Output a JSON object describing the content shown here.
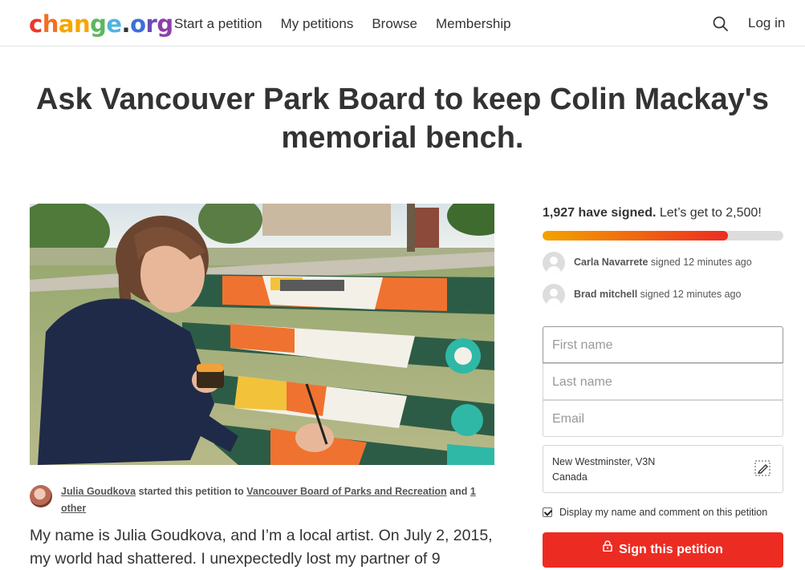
{
  "header": {
    "logo_parts": [
      "c",
      "h",
      "a",
      "n",
      "g",
      "e",
      ".",
      "o",
      "r",
      "g"
    ],
    "logo_colors": [
      "#e8392b",
      "#f36f21",
      "#f7a600",
      "#f7a600",
      "#5db75e",
      "#4fb2e0",
      "#333333",
      "#3e6fd6",
      "#6b4bb5",
      "#8c3fa8"
    ],
    "nav": [
      "Start a petition",
      "My petitions",
      "Browse",
      "Membership"
    ],
    "search_icon": "search-icon",
    "login_label": "Log in"
  },
  "petition": {
    "title": "Ask Vancouver Park Board to keep Colin Mackay's memorial bench.",
    "starter_name": "Julia Goudkova",
    "starter_mid": " started this petition to ",
    "target_org": "Vancouver Board of Parks and Recreation",
    "target_and": " and ",
    "target_other": "1 other",
    "story": "My name is Julia Goudkova, and I’m a local artist. On July 2, 2015, my world had shattered. I unexpectedly lost my partner of 9"
  },
  "progress": {
    "signed_count": "1,927 have signed.",
    "goal_text": " Let’s get to 2,500!",
    "fraction": 0.7708,
    "fill_color": "#ec2c22"
  },
  "signers": [
    {
      "name": "Carla Navarrete",
      "action": " signed 12 minutes ago"
    },
    {
      "name": "Brad mitchell",
      "action": " signed 12 minutes ago"
    }
  ],
  "form": {
    "first_name_placeholder": "First name",
    "last_name_placeholder": "Last name",
    "email_placeholder": "Email",
    "location_line1": "New Westminster, V3N",
    "location_line2": "Canada",
    "edit_icon": "pencil-edit-icon",
    "display_label": "Display my name and comment on this petition",
    "display_checked": true,
    "sign_label": "Sign this petition",
    "sign_icon": "lock-icon",
    "button_color": "#ec2c22"
  }
}
